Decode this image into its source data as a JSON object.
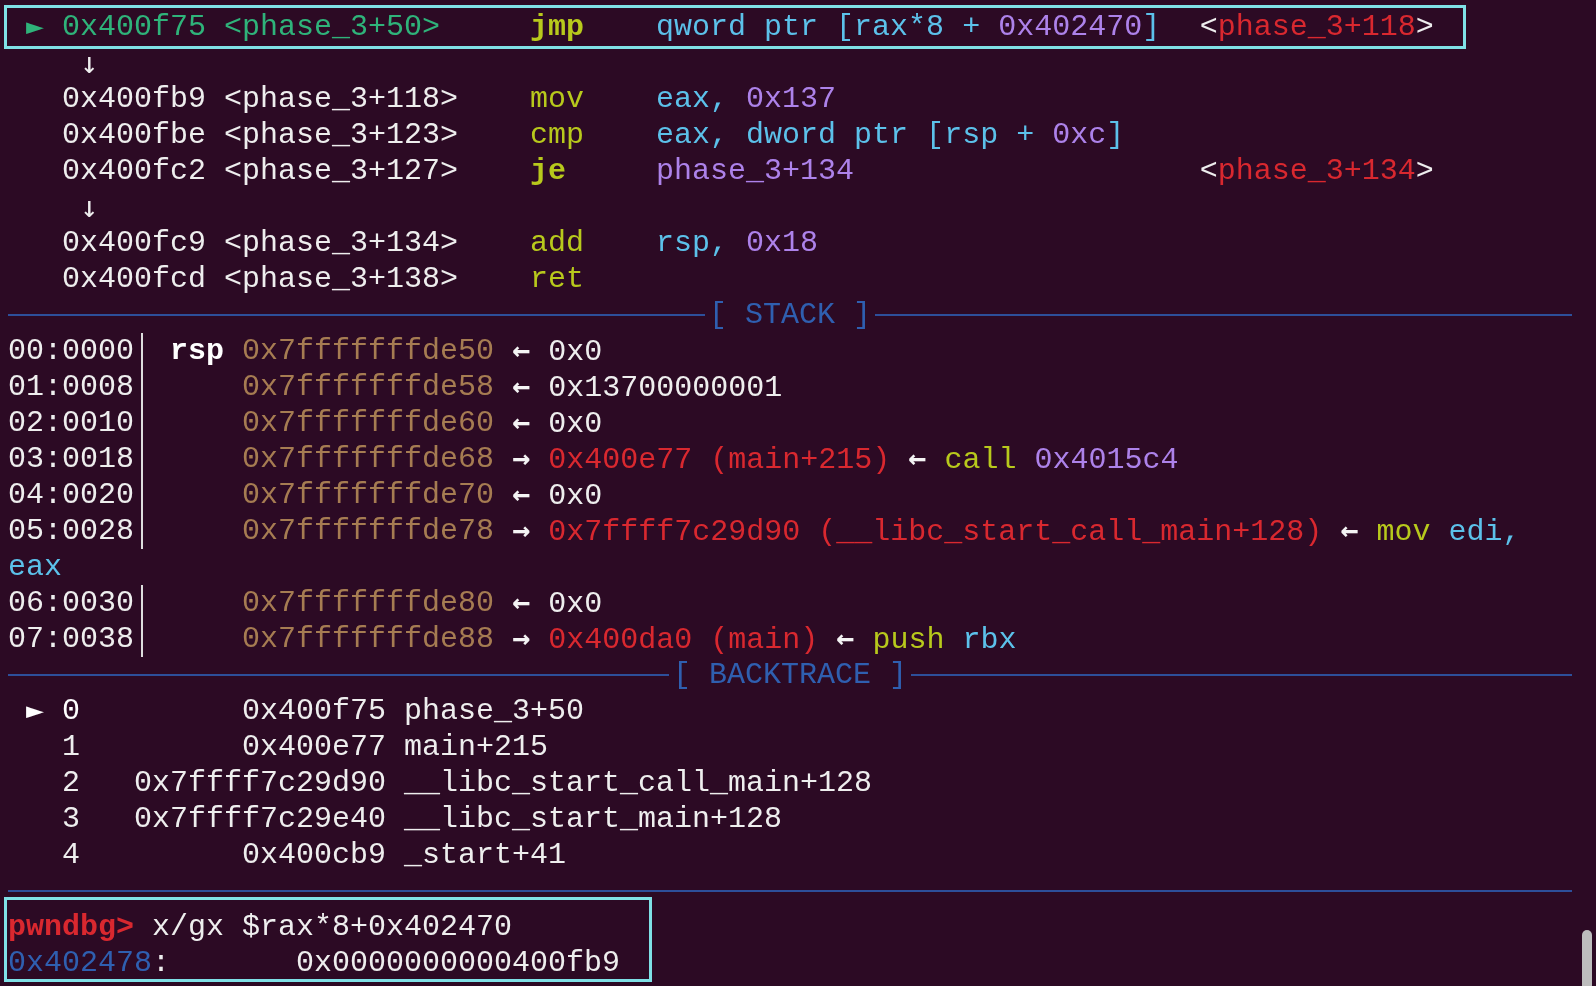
{
  "disassembly": {
    "lines": [
      {
        "kind": "instr",
        "current": true,
        "highlighted": true,
        "marker": "►",
        "address": "0x400f75",
        "symbol": "<phase_3+50>",
        "mnemonic": {
          "text": "jmp",
          "bold": true
        },
        "operands": [
          {
            "kind": "reg",
            "text": "qword ptr [rax*8 + "
          },
          {
            "kind": "num",
            "text": "0x402470"
          },
          {
            "kind": "reg",
            "text": "]"
          }
        ],
        "target": [
          {
            "kind": "plain",
            "text": "<"
          },
          {
            "kind": "red",
            "text": "phase_3+118"
          },
          {
            "kind": "plain",
            "text": ">"
          }
        ]
      },
      {
        "kind": "arrow",
        "text": "↓"
      },
      {
        "kind": "instr",
        "current": false,
        "highlighted": false,
        "address": "0x400fb9",
        "symbol": "<phase_3+118>",
        "mnemonic": {
          "text": "mov",
          "bold": false
        },
        "operands": [
          {
            "kind": "reg",
            "text": "eax, "
          },
          {
            "kind": "num",
            "text": "0x137"
          }
        ]
      },
      {
        "kind": "instr",
        "current": false,
        "highlighted": false,
        "address": "0x400fbe",
        "symbol": "<phase_3+123>",
        "mnemonic": {
          "text": "cmp",
          "bold": false
        },
        "operands": [
          {
            "kind": "reg",
            "text": "eax, dword ptr [rsp + "
          },
          {
            "kind": "num",
            "text": "0xc"
          },
          {
            "kind": "reg",
            "text": "]"
          }
        ]
      },
      {
        "kind": "instr",
        "current": false,
        "highlighted": false,
        "address": "0x400fc2",
        "symbol": "<phase_3+127>",
        "mnemonic": {
          "text": "je",
          "bold": true
        },
        "operands": [
          {
            "kind": "num",
            "text": "phase_3+134"
          }
        ],
        "target": [
          {
            "kind": "plain",
            "text": "<"
          },
          {
            "kind": "red",
            "text": "phase_3+134"
          },
          {
            "kind": "plain",
            "text": ">"
          }
        ]
      },
      {
        "kind": "arrow",
        "text": "↓"
      },
      {
        "kind": "instr",
        "current": false,
        "highlighted": false,
        "address": "0x400fc9",
        "symbol": "<phase_3+134>",
        "mnemonic": {
          "text": "add",
          "bold": false
        },
        "operands": [
          {
            "kind": "reg",
            "text": "rsp, "
          },
          {
            "kind": "num",
            "text": "0x18"
          }
        ]
      },
      {
        "kind": "instr",
        "current": false,
        "highlighted": false,
        "address": "0x400fcd",
        "symbol": "<phase_3+138>",
        "mnemonic": {
          "text": "ret",
          "bold": false
        }
      }
    ]
  },
  "stack": {
    "title": "[ STACK ]",
    "rows": [
      {
        "offset": "00:0000",
        "register": "rsp",
        "address": "0x7fffffffde50",
        "chain": [
          {
            "kind": "arrow",
            "text": "←"
          },
          {
            "kind": "plain",
            "text": "0x0"
          }
        ]
      },
      {
        "offset": "01:0008",
        "address": "0x7fffffffde58",
        "chain": [
          {
            "kind": "arrow",
            "text": "←"
          },
          {
            "kind": "plain",
            "text": "0x13700000001"
          }
        ]
      },
      {
        "offset": "02:0010",
        "address": "0x7fffffffde60",
        "chain": [
          {
            "kind": "arrow",
            "text": "←"
          },
          {
            "kind": "plain",
            "text": "0x0"
          }
        ]
      },
      {
        "offset": "03:0018",
        "address": "0x7fffffffde68",
        "chain": [
          {
            "kind": "arrow",
            "text": "→"
          },
          {
            "kind": "red",
            "text": "0x400e77 (main+215)"
          },
          {
            "kind": "arrow",
            "text": "←"
          },
          {
            "kind": "mnem",
            "text": "call "
          },
          {
            "kind": "num",
            "text": "0x4015c4"
          }
        ]
      },
      {
        "offset": "04:0020",
        "address": "0x7fffffffde70",
        "chain": [
          {
            "kind": "arrow",
            "text": "←"
          },
          {
            "kind": "plain",
            "text": "0x0"
          }
        ]
      },
      {
        "offset": "05:0028",
        "address": "0x7fffffffde78",
        "chain": [
          {
            "kind": "arrow",
            "text": "→"
          },
          {
            "kind": "red",
            "text": "0x7ffff7c29d90 (__libc_start_call_main+128)"
          },
          {
            "kind": "arrow",
            "text": "←"
          },
          {
            "kind": "mnem",
            "text": "mov "
          },
          {
            "kind": "reg",
            "text": "edi,"
          }
        ],
        "wrapped": [
          {
            "kind": "reg",
            "text": "eax"
          }
        ]
      },
      {
        "offset": "06:0030",
        "address": "0x7fffffffde80",
        "chain": [
          {
            "kind": "arrow",
            "text": "←"
          },
          {
            "kind": "plain",
            "text": "0x0"
          }
        ]
      },
      {
        "offset": "07:0038",
        "address": "0x7fffffffde88",
        "chain": [
          {
            "kind": "arrow",
            "text": "→"
          },
          {
            "kind": "red",
            "text": "0x400da0 (main)"
          },
          {
            "kind": "arrow",
            "text": "←"
          },
          {
            "kind": "mnem",
            "text": "push "
          },
          {
            "kind": "reg",
            "text": "rbx"
          }
        ]
      }
    ]
  },
  "backtrace": {
    "title": "[ BACKTRACE ]",
    "frames": [
      {
        "selected": true,
        "marker": "►",
        "index": "0",
        "address": "0x400f75",
        "symbol": "phase_3+50"
      },
      {
        "selected": false,
        "index": "1",
        "address": "0x400e77",
        "symbol": "main+215"
      },
      {
        "selected": false,
        "index": "2",
        "address": "0x7ffff7c29d90",
        "symbol": "__libc_start_call_main+128"
      },
      {
        "selected": false,
        "index": "3",
        "address": "0x7ffff7c29e40",
        "symbol": "__libc_start_main+128"
      },
      {
        "selected": false,
        "index": "4",
        "address": "0x400cb9",
        "symbol": "_start+41"
      }
    ]
  },
  "console": {
    "highlighted": true,
    "prompt": "pwndbg>",
    "command": "x/gx $rax*8+0x402470",
    "output": {
      "address": "0x402478",
      "separator": ":",
      "value": "0x0000000000400fb9"
    }
  }
}
